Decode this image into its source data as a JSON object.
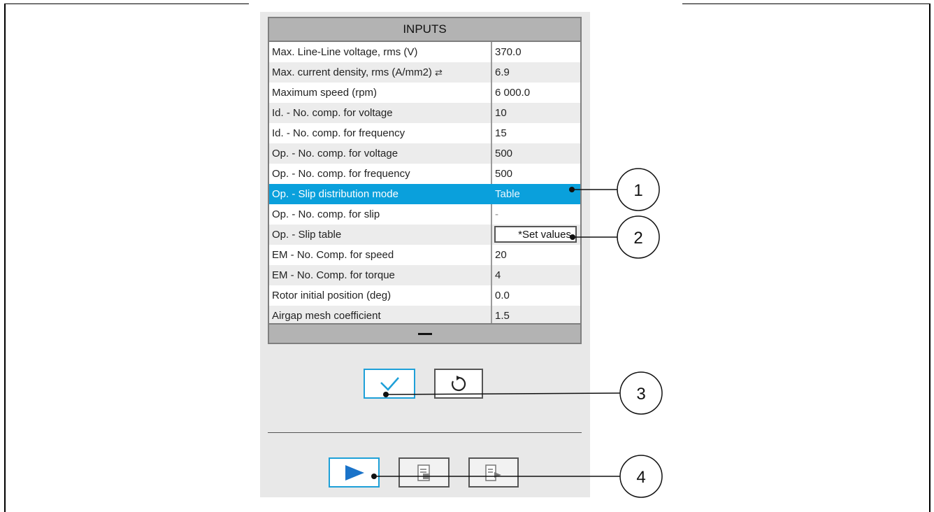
{
  "inputs": {
    "title": "INPUTS",
    "rows": [
      {
        "label": "Max. Line-Line voltage, rms (V)",
        "value": "370.0"
      },
      {
        "label": "Max. current density, rms (A/mm2)",
        "value": "6.9"
      },
      {
        "label": "Maximum speed (rpm)",
        "value": "6 000.0"
      },
      {
        "label": "Id. - No. comp. for voltage",
        "value": "10"
      },
      {
        "label": "Id. - No. comp. for frequency",
        "value": "15"
      },
      {
        "label": "Op. - No. comp. for voltage",
        "value": "500"
      },
      {
        "label": "Op. - No. comp. for frequency",
        "value": "500"
      },
      {
        "label": "Op. - Slip distribution mode",
        "value": "Table"
      },
      {
        "label": "Op. - No. comp. for slip",
        "value": "-"
      },
      {
        "label": "Op. - Slip table",
        "value": "*Set values"
      },
      {
        "label": "EM - No. Comp. for speed",
        "value": "20"
      },
      {
        "label": "EM - No. Comp. for torque",
        "value": "4"
      },
      {
        "label": "Rotor initial position (deg)",
        "value": "0.0"
      },
      {
        "label": "Airgap mesh coefficient",
        "value": "1.5"
      }
    ]
  },
  "icons": {
    "swap": "swap-arrows-icon",
    "check": "checkmark-icon",
    "reset": "reset-icon",
    "run": "play-icon",
    "doc1": "document-icon",
    "doc2": "document-export-icon",
    "minimize": "minimize-icon"
  },
  "callouts": [
    "1",
    "2",
    "3",
    "4"
  ],
  "colors": {
    "accent": "#0aa0dc",
    "header": "#b3b3b3",
    "panel": "#e8e8e8"
  }
}
